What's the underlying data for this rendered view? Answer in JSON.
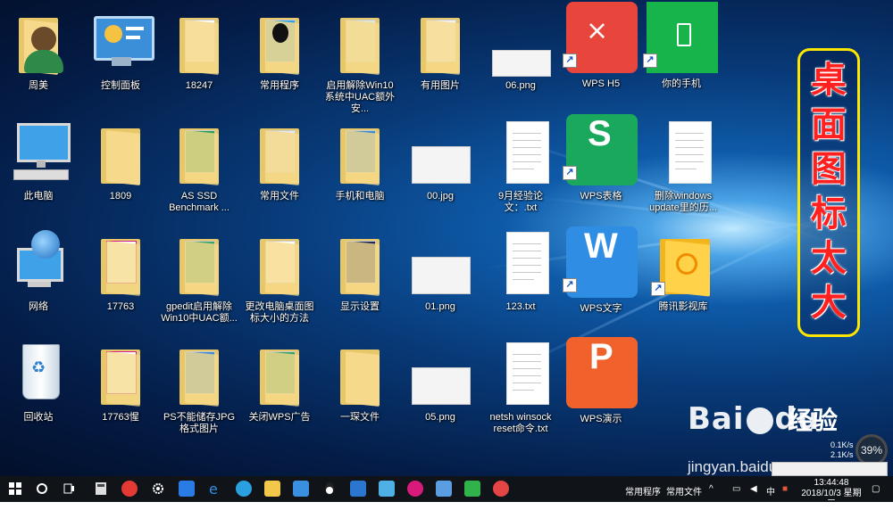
{
  "desktop": {
    "icons": [
      {
        "label": "周美"
      },
      {
        "label": "控制面板"
      },
      {
        "label": "18247"
      },
      {
        "label": "常用程序"
      },
      {
        "label": "启用解除Win10系统中UAC额外安..."
      },
      {
        "label": "有用图片"
      },
      {
        "label": "06.png"
      },
      {
        "label": "WPS H5"
      },
      {
        "label": "你的手机"
      },
      {
        "label": "此电脑"
      },
      {
        "label": "1809"
      },
      {
        "label": "AS SSD Benchmark ..."
      },
      {
        "label": "常用文件"
      },
      {
        "label": "手机和电脑"
      },
      {
        "label": "00.jpg"
      },
      {
        "label": "9月经验论文：.txt"
      },
      {
        "label": "WPS表格"
      },
      {
        "label": "删除windows update里的历..."
      },
      {
        "label": "网络"
      },
      {
        "label": "17763"
      },
      {
        "label": "gpedit启用解除Win10中UAC额..."
      },
      {
        "label": "更改电脑桌面图标大小的方法"
      },
      {
        "label": "显示设置"
      },
      {
        "label": "01.png"
      },
      {
        "label": "123.txt"
      },
      {
        "label": "WPS文字"
      },
      {
        "label": "腾讯影视库"
      },
      {
        "label": "回收站"
      },
      {
        "label": "17763惺"
      },
      {
        "label": "PS不能储存JPG格式图片"
      },
      {
        "label": "关闭WPS广告"
      },
      {
        "label": "一琛文件"
      },
      {
        "label": "05.png"
      },
      {
        "label": "netsh winsock reset命令.txt"
      },
      {
        "label": "WPS演示"
      }
    ],
    "annotation": {
      "chars": [
        "桌",
        "面",
        "图",
        "标",
        "太",
        "大"
      ]
    },
    "watermark": {
      "brand": "Bai",
      "brand2": "du",
      "brand3": "经验",
      "site": "jingyan.baidu.com"
    },
    "perf": {
      "cpu": "39%",
      "up": "0.1K/s",
      "down": "2.1K/s"
    }
  },
  "taskbar": {
    "toolbar_1": "常用程序",
    "toolbar_2": "常用文件",
    "lang": "中",
    "time": "13:44:48",
    "date": "2018/10/3 星期三"
  },
  "colors": {
    "wps_red": "#e8453c",
    "phone_green": "#17b44b",
    "wps_green": "#1aa85d",
    "wps_blue": "#2f8ee4",
    "wps_orange": "#f0612c",
    "annotation": "#ffe600",
    "annotation_text": "#ff2020"
  }
}
